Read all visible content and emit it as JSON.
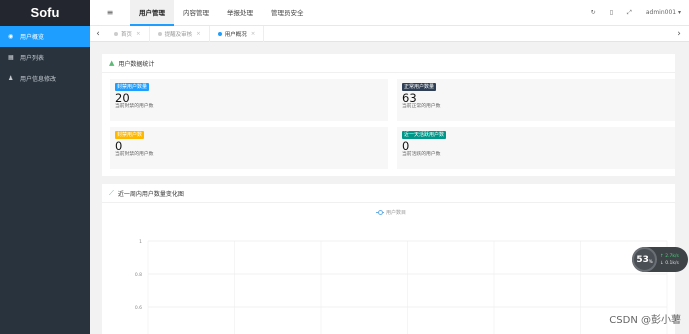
{
  "sidebar": {
    "logo": "Sofu",
    "items": [
      {
        "label": "用户概览",
        "icon": "dashboard-icon",
        "active": true
      },
      {
        "label": "用户列表",
        "icon": "users-icon",
        "active": false
      },
      {
        "label": "用户信息修改",
        "icon": "user-edit-icon",
        "active": false
      }
    ]
  },
  "topbar": {
    "menu_icon": "≡",
    "menus": [
      "用户管理",
      "内容管理",
      "举报处理",
      "管理员安全"
    ],
    "active_menu": "用户管理",
    "user": "admin001 ▾"
  },
  "tabs": [
    {
      "label": "首页",
      "active": false
    },
    {
      "label": "提醒及审核",
      "active": false
    },
    {
      "label": "用户概况",
      "active": true
    }
  ],
  "stats_card": {
    "title": "用户数据统计",
    "items": [
      {
        "badge": "封禁用户数量",
        "badge_color": "#1e9fff",
        "value": "20",
        "desc": "当前封禁的用户数"
      },
      {
        "badge": "正常用户数量",
        "badge_color": "#2f4056",
        "value": "63",
        "desc": "当前正常的用户数"
      },
      {
        "badge": "封禁用户数",
        "badge_color": "#ffb800",
        "value": "0",
        "desc": "当前封禁的用户数"
      },
      {
        "badge": "近一天活跃用户数",
        "badge_color": "#009688",
        "value": "0",
        "desc": "当前活跃的用户数"
      }
    ]
  },
  "chart_card": {
    "title": "近一周内用户数量变化图"
  },
  "chart_data": {
    "type": "line",
    "series": [
      {
        "name": "用户数目",
        "values": []
      }
    ],
    "yticks": [
      "1",
      "0.8",
      "0.6"
    ],
    "ylim": [
      0.6,
      1
    ],
    "grid": true,
    "legend": "top-center"
  },
  "floating_widget": {
    "percent": "53",
    "percent_unit": "%",
    "up": "↑ 2.7k/s",
    "down": "↓ 0.1k/s"
  },
  "watermark": "CSDN @彭小薯"
}
